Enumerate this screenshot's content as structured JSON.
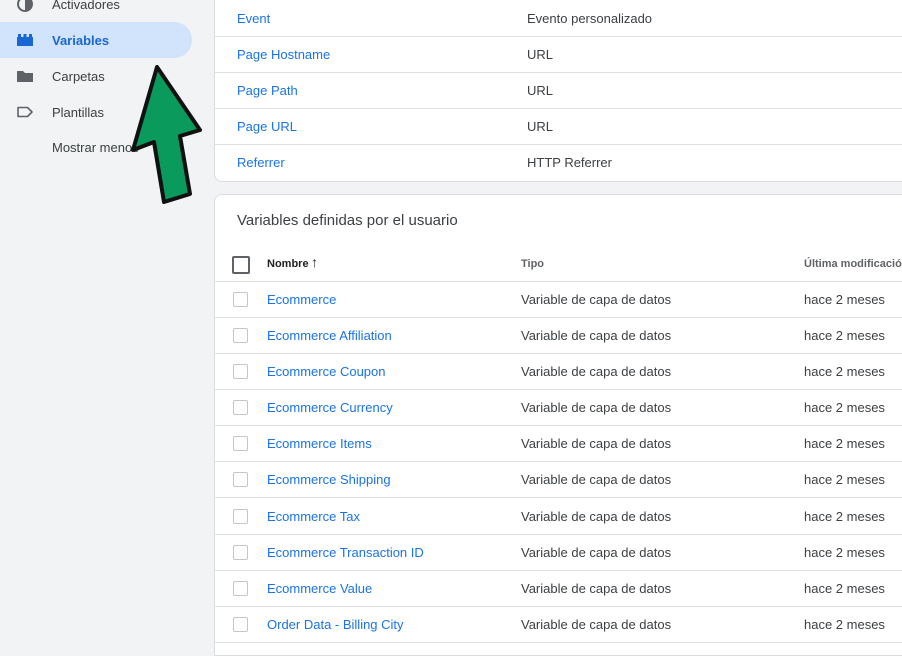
{
  "sidebar": {
    "items": [
      {
        "label": "Activadores",
        "icon": "trigger-icon"
      },
      {
        "label": "Variables",
        "icon": "variables-icon",
        "active": true
      },
      {
        "label": "Carpetas",
        "icon": "folder-icon"
      },
      {
        "label": "Plantillas",
        "icon": "template-label-icon"
      }
    ],
    "more_label": "Mostrar menos"
  },
  "builtin": {
    "rows": [
      {
        "name": "Event",
        "type": "Evento personalizado"
      },
      {
        "name": "Page Hostname",
        "type": "URL"
      },
      {
        "name": "Page Path",
        "type": "URL"
      },
      {
        "name": "Page URL",
        "type": "URL"
      },
      {
        "name": "Referrer",
        "type": "HTTP Referrer"
      }
    ]
  },
  "user": {
    "title": "Variables definidas por el usuario",
    "columns": {
      "name": "Nombre",
      "sort_icon": "arrow-up-icon",
      "type": "Tipo",
      "modified": "Última modificación"
    },
    "rows": [
      {
        "name": "Ecommerce",
        "type": "Variable de capa de datos",
        "modified": "hace 2 meses"
      },
      {
        "name": "Ecommerce Affiliation",
        "type": "Variable de capa de datos",
        "modified": "hace 2 meses"
      },
      {
        "name": "Ecommerce Coupon",
        "type": "Variable de capa de datos",
        "modified": "hace 2 meses"
      },
      {
        "name": "Ecommerce Currency",
        "type": "Variable de capa de datos",
        "modified": "hace 2 meses"
      },
      {
        "name": "Ecommerce Items",
        "type": "Variable de capa de datos",
        "modified": "hace 2 meses"
      },
      {
        "name": "Ecommerce Shipping",
        "type": "Variable de capa de datos",
        "modified": "hace 2 meses"
      },
      {
        "name": "Ecommerce Tax",
        "type": "Variable de capa de datos",
        "modified": "hace 2 meses"
      },
      {
        "name": "Ecommerce Transaction ID",
        "type": "Variable de capa de datos",
        "modified": "hace 2 meses"
      },
      {
        "name": "Ecommerce Value",
        "type": "Variable de capa de datos",
        "modified": "hace 2 meses"
      },
      {
        "name": "Order Data - Billing City",
        "type": "Variable de capa de datos",
        "modified": "hace 2 meses"
      }
    ]
  },
  "annotation": {
    "icon": "green-arrow-icon",
    "color": "#0a9a5c"
  },
  "colors": {
    "link": "#1a73e8",
    "active_bg": "#d2e3fc",
    "active_text": "#1967d2",
    "sidebar_bg": "#f1f3f4"
  }
}
